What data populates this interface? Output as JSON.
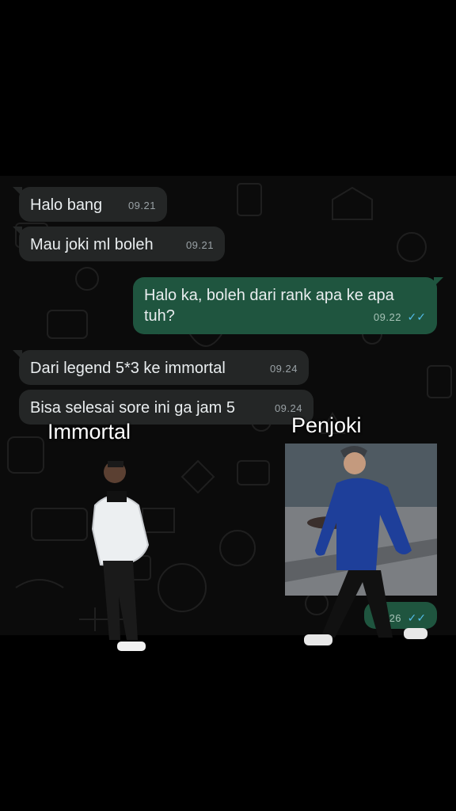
{
  "messages": [
    {
      "text": "Halo bang",
      "time": "09.21",
      "direction": "incoming"
    },
    {
      "text": "Mau joki ml boleh",
      "time": "09.21",
      "direction": "incoming"
    },
    {
      "text_line1": "Halo ka, boleh dari rank apa ke apa",
      "text_line2": "tuh?",
      "time": "09.22",
      "direction": "outgoing",
      "status": "read"
    },
    {
      "text": "Dari legend 5*3 ke immortal",
      "time": "09.24",
      "direction": "incoming"
    },
    {
      "text": "Bisa selesai sore ini ga jam 5",
      "time": "09.24",
      "direction": "incoming"
    },
    {
      "time": "09.26",
      "direction": "outgoing",
      "status": "read",
      "content": "photo"
    }
  ],
  "captions": {
    "left": "Immortal",
    "right": "Penjoki"
  },
  "icons": {
    "read_receipt": "double-check-icon"
  },
  "colors": {
    "incoming_bubble": "#242626",
    "outgoing_bubble": "#1f553f",
    "read_ticks": "#53bdeb"
  }
}
